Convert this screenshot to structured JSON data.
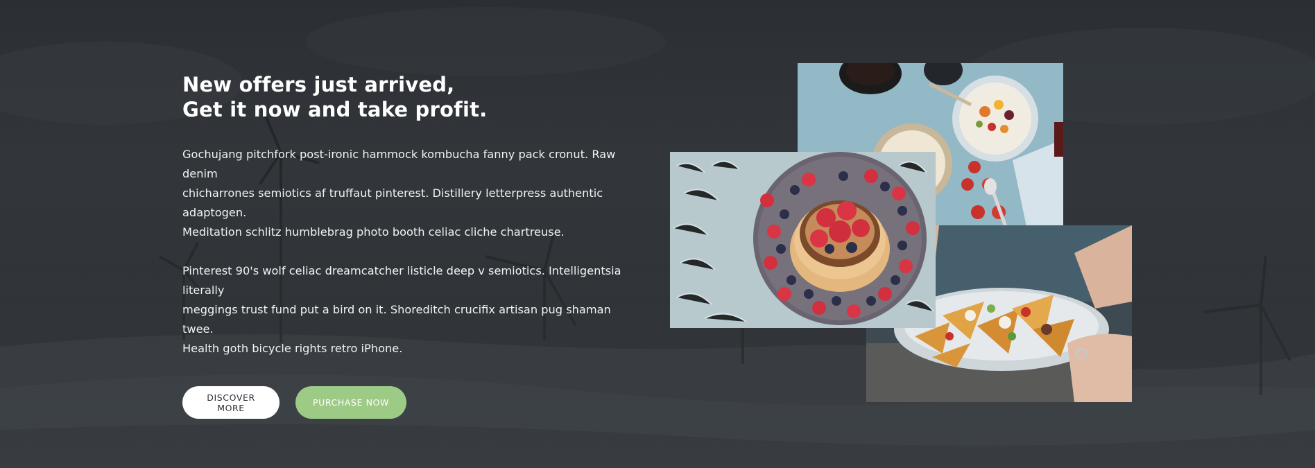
{
  "hero": {
    "headline_line1": "New offers just arrived,",
    "headline_line2": "Get it now and take profit.",
    "paragraph1_line1": "Gochujang pitchfork post-ironic hammock kombucha fanny pack cronut. Raw denim",
    "paragraph1_line2": "chicharrones semiotics af truffaut pinterest. Distillery letterpress authentic adaptogen.",
    "paragraph1_line3": "Meditation schlitz humblebrag photo booth celiac cliche chartreuse.",
    "paragraph2_line1": "Pinterest 90's wolf celiac dreamcatcher listicle deep v semiotics. Intelligentsia literally",
    "paragraph2_line2": "meggings trust fund put a bird on it. Shoreditch crucifix artisan pug shaman twee.",
    "paragraph2_line3": "Health goth bicycle rights retro iPhone."
  },
  "buttons": {
    "discover_label": "DISCOVER MORE",
    "purchase_label": "PURCHASE NOW"
  },
  "colors": {
    "background": "#2f3337",
    "purchase_button": "#9dcb86",
    "discover_button": "#ffffff"
  },
  "images": {
    "top": "breakfast-bowls-photo",
    "middle": "pancakes-berries-photo",
    "bottom": "nachos-photo"
  }
}
